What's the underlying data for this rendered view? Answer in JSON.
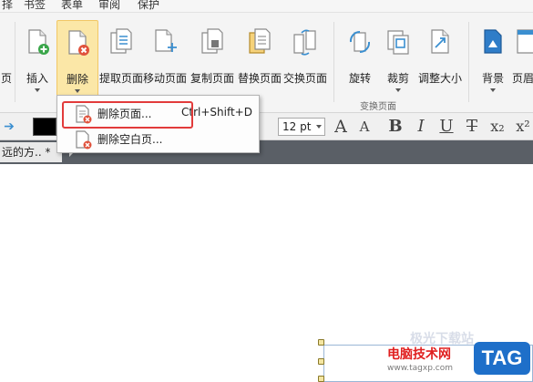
{
  "menu_tabs": [
    "择",
    "书签",
    "表单",
    "审阅",
    "保护"
  ],
  "ribbon": {
    "buttons": {
      "partial_left": "页",
      "insert": "插入",
      "delete": "删除",
      "extract": "提取页面",
      "move": "移动页面",
      "copy": "复制页面",
      "replace": "替换页面",
      "swap": "交换页面",
      "rotate": "旋转",
      "crop": "裁剪",
      "resize": "调整大小",
      "background": "背景",
      "header_partial": "页眉"
    },
    "group_label": "变换页面"
  },
  "format_toolbar": {
    "font_size": "12 pt",
    "icons": [
      "font-grow-icon",
      "font-shrink-icon",
      "bold-icon",
      "italic-icon",
      "underline-icon",
      "strikethrough-icon",
      "subscript-icon",
      "superscript-icon"
    ],
    "color": "#000000"
  },
  "document_tab": {
    "title": "远的方.. *",
    "close": "✕"
  },
  "dropdown": {
    "items": [
      {
        "label": "删除页面...",
        "shortcut": "Ctrl+Shift+D"
      },
      {
        "label": "删除空白页..."
      }
    ]
  },
  "watermark": {
    "faint": "极光下载站",
    "site": "电脑技术网",
    "url": "www.tagxp.com",
    "tag": "TAG"
  },
  "colors": {
    "highlight": "#e23b3b",
    "active_button": "#fbe7a7",
    "tab_bar": "#5a5f66",
    "accent_blue": "#1e6fc9"
  }
}
